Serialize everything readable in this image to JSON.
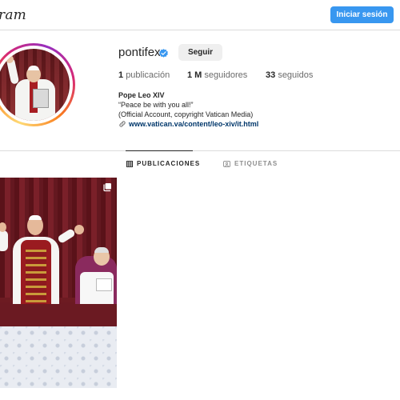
{
  "header": {
    "logo_text": "ram",
    "login_label": "Iniciar sesión"
  },
  "profile": {
    "username": "pontifex",
    "verified": true,
    "follow_label": "Seguir",
    "stats": [
      {
        "value": "1",
        "label": "publicación"
      },
      {
        "value": "1 M",
        "label": "seguidores"
      },
      {
        "value": "33",
        "label": "seguidos"
      }
    ],
    "bio": {
      "name": "Pope Leo XIV",
      "lines": [
        "“Peace be with you all!”",
        "(Official Account, copyright Vatican Media)"
      ],
      "link": "www.vatican.va/content/leo-xiv/it.html"
    }
  },
  "tabs": [
    {
      "label": "PUBLICACIONES",
      "icon": "grid-icon",
      "active": true
    },
    {
      "label": "ETIQUETAS",
      "icon": "tag-icon",
      "active": false
    }
  ],
  "posts": [
    {
      "kind": "carousel",
      "icon": "multiple-images-icon"
    }
  ],
  "colors": {
    "accent": "#3897f0",
    "link": "#00376b",
    "verified": "#3897f0",
    "border": "#dbdbdb"
  }
}
